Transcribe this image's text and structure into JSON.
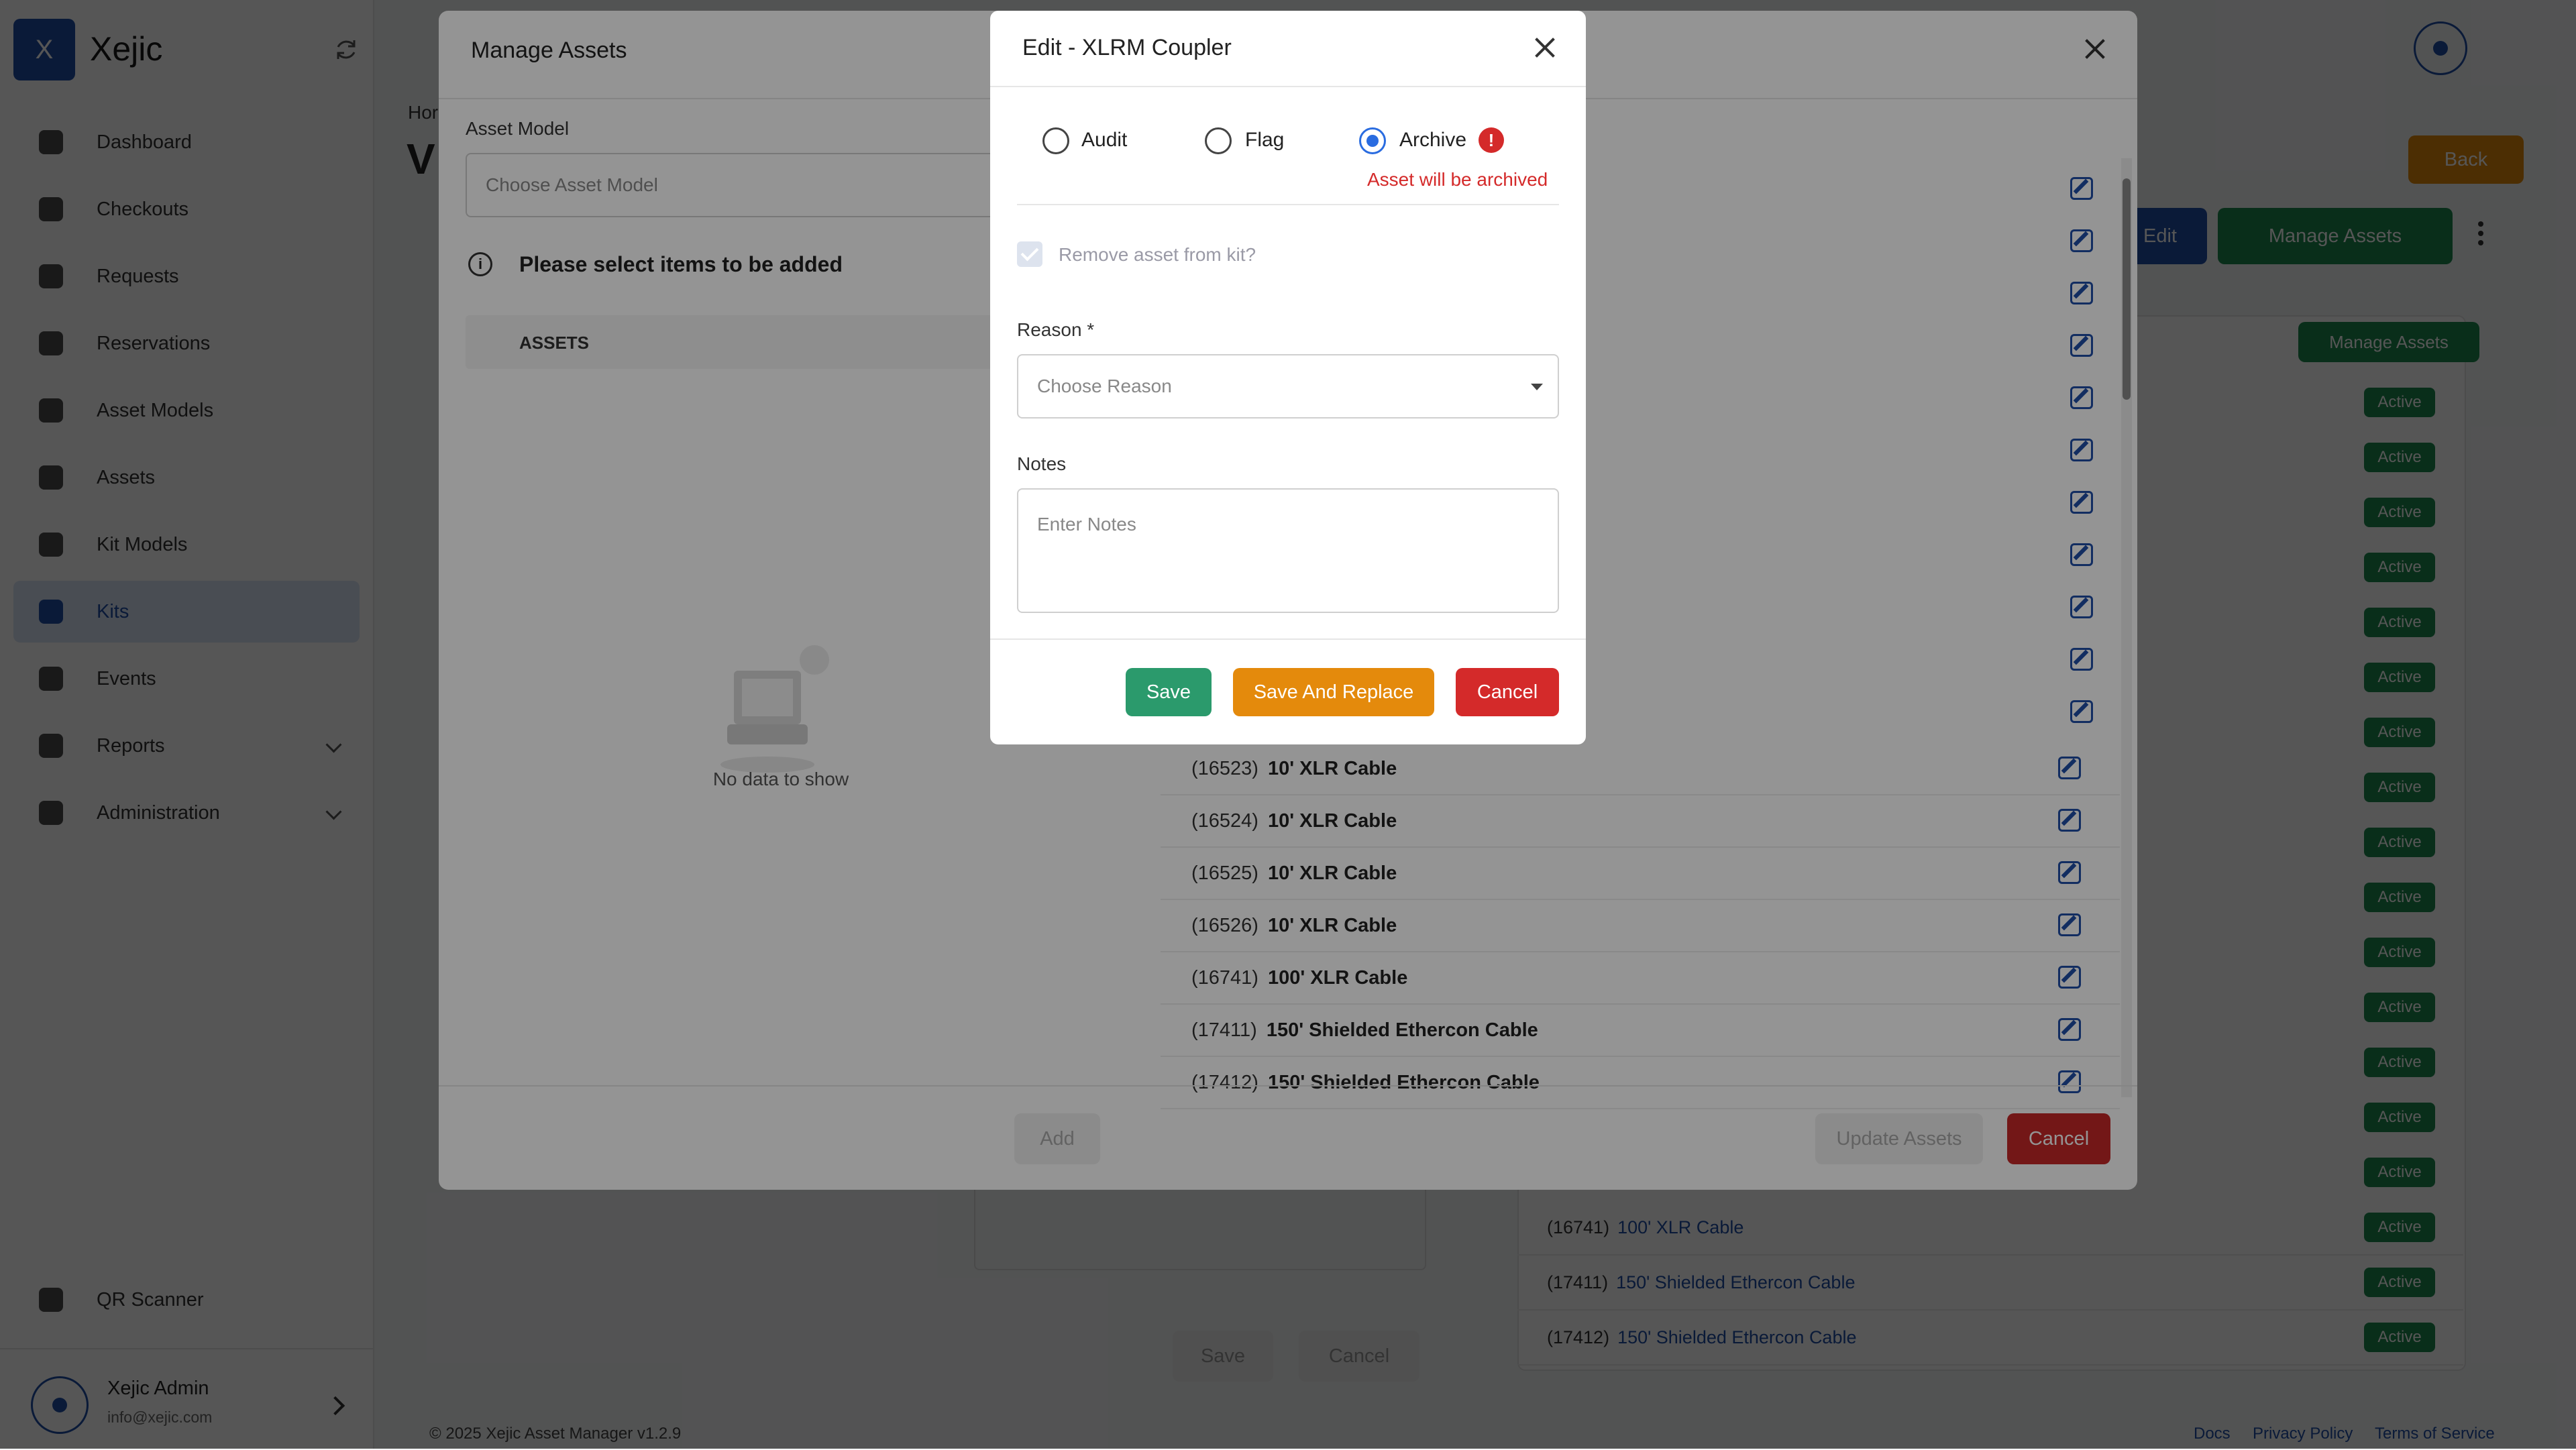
{
  "app": {
    "logo_letter": "X",
    "name": "Xejic"
  },
  "sidebar": {
    "items": [
      {
        "label": "Dashboard"
      },
      {
        "label": "Checkouts"
      },
      {
        "label": "Requests"
      },
      {
        "label": "Reservations"
      },
      {
        "label": "Asset Models"
      },
      {
        "label": "Assets"
      },
      {
        "label": "Kit Models"
      },
      {
        "label": "Kits"
      },
      {
        "label": "Events"
      },
      {
        "label": "Reports"
      },
      {
        "label": "Administration"
      }
    ],
    "qr_label": "QR Scanner",
    "user": {
      "name": "Xejic Admin",
      "email": "info@xejic.com"
    }
  },
  "page": {
    "breadcrumb_fragment": "Hor",
    "title_fragment": "V",
    "back_label": "Back",
    "edit_label": "Edit",
    "manage_assets_label": "Manage Assets",
    "manage_assets_small_label": "Manage Assets",
    "bg_rows": [
      {
        "id": "(16741)",
        "name": "100' XLR Cable",
        "status": "Active"
      },
      {
        "id": "(17411)",
        "name": "150' Shielded Ethercon Cable",
        "status": "Active"
      },
      {
        "id": "(17412)",
        "name": "150' Shielded Ethercon Cable",
        "status": "Active"
      }
    ],
    "status_active": "Active",
    "bg_save": "Save",
    "bg_cancel": "Cancel"
  },
  "footer": {
    "copyright": "© 2025 Xejic Asset Manager v1.2.9",
    "docs": "Docs",
    "privacy": "Privacy Policy",
    "terms": "Terms of Service"
  },
  "manage_assets_modal": {
    "title": "Manage Assets",
    "asset_model_label": "Asset Model",
    "asset_model_placeholder": "Choose Asset Model",
    "info_text": "Please select items to be added",
    "assets_header": "ASSETS",
    "empty_text": "No data to show",
    "add_label": "Add",
    "update_label": "Update Assets",
    "cancel_label": "Cancel",
    "rows": [
      {
        "id": "(16523)",
        "name": "10' XLR Cable"
      },
      {
        "id": "(16524)",
        "name": "10' XLR Cable"
      },
      {
        "id": "(16525)",
        "name": "10' XLR Cable"
      },
      {
        "id": "(16526)",
        "name": "10' XLR Cable"
      },
      {
        "id": "(16741)",
        "name": "100' XLR Cable"
      },
      {
        "id": "(17411)",
        "name": "150' Shielded Ethercon Cable"
      },
      {
        "id": "(17412)",
        "name": "150' Shielded Ethercon Cable"
      }
    ]
  },
  "edit_dialog": {
    "title": "Edit - XLRM Coupler",
    "options": [
      {
        "label": "Audit",
        "selected": false
      },
      {
        "label": "Flag",
        "selected": false
      },
      {
        "label": "Archive",
        "selected": true
      }
    ],
    "warning_mark": "!",
    "warning": "Asset will be archived",
    "remove_label": "Remove asset from kit?",
    "reason_label": "Reason *",
    "reason_placeholder": "Choose Reason",
    "notes_label": "Notes",
    "notes_placeholder": "Enter Notes",
    "save_label": "Save",
    "save_replace_label": "Save And Replace",
    "cancel_label": "Cancel"
  },
  "colors": {
    "primary": "#1f4fa8",
    "success": "#1d8a4e",
    "save_green": "#2b9a6c",
    "orange": "#e48a0c",
    "danger": "#d42a2a",
    "radio_blue": "#2a6ce0"
  }
}
